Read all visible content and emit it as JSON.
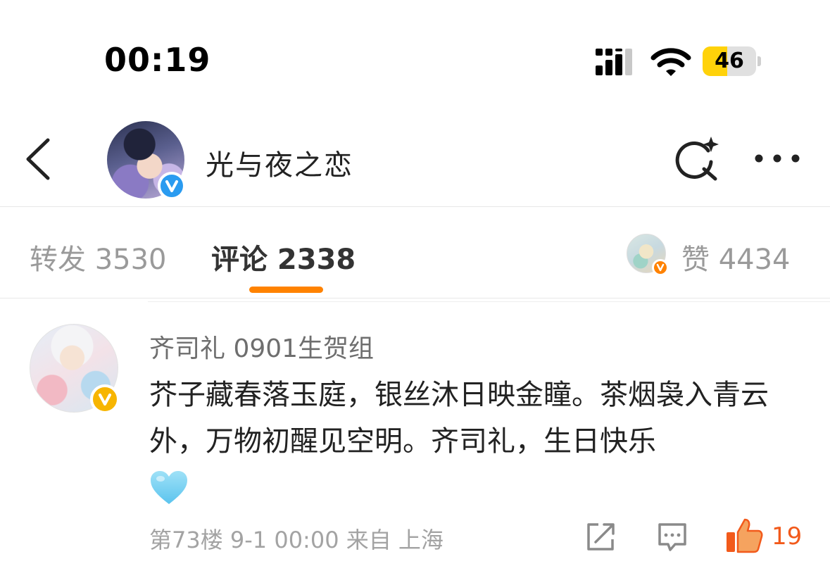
{
  "status_bar": {
    "time": "00:19",
    "battery": "46",
    "battery_level": 0.46
  },
  "header": {
    "title": "光与夜之恋"
  },
  "tabs": {
    "repost": "转发 3530",
    "comments": "评论 2338",
    "likes": "赞 4434"
  },
  "comment": {
    "author": "齐司礼 0901生贺组",
    "text": "芥子藏春落玉庭，银丝沐日映金瞳。茶烟袅入青云外，万物初醒见空明。齐司礼，生日快乐",
    "emoji": "blue-heart",
    "meta": "第73楼 9-1 00:00 来自 上海",
    "like_count": "19"
  },
  "colors": {
    "accent": "#ff8200",
    "like": "#f25a1b",
    "verified_blue": "#2a9bf0",
    "verified_gold": "#f7b500",
    "battery": "#ffd20a"
  }
}
